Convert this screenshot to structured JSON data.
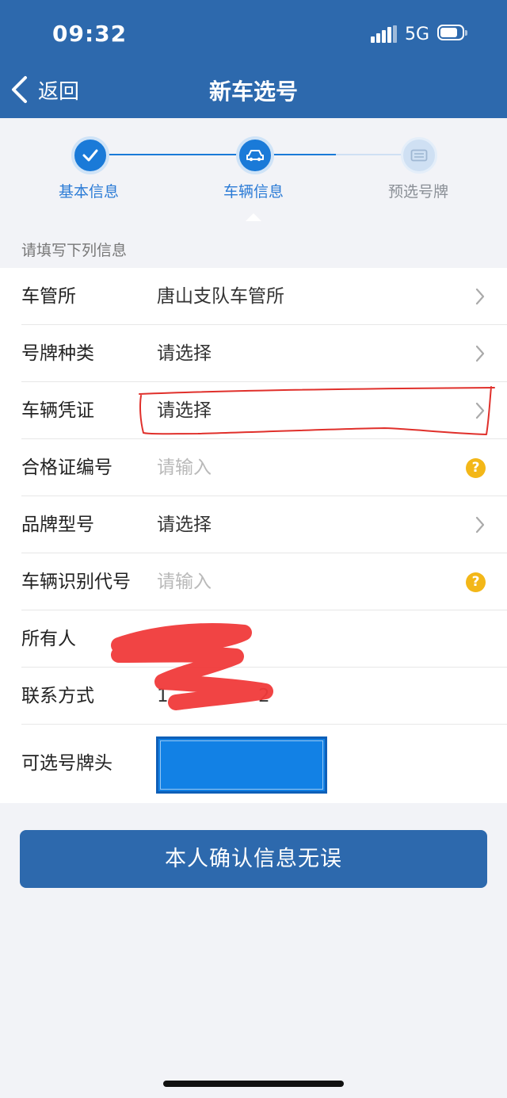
{
  "status_bar": {
    "time": "09:32",
    "network": "5G"
  },
  "nav": {
    "back_label": "返回",
    "title": "新车选号"
  },
  "steps": [
    {
      "label": "基本信息",
      "state": "done"
    },
    {
      "label": "车辆信息",
      "state": "current"
    },
    {
      "label": "预选号牌",
      "state": "pending"
    }
  ],
  "form": {
    "hint": "请填写下列信息",
    "rows": [
      {
        "label": "车管所",
        "value": "唐山支队车管所",
        "control": "chevron"
      },
      {
        "label": "号牌种类",
        "value": "请选择",
        "control": "chevron"
      },
      {
        "label": "车辆凭证",
        "value": "请选择",
        "control": "chevron"
      },
      {
        "label": "合格证编号",
        "placeholder": "请输入",
        "control": "help-icon"
      },
      {
        "label": "品牌型号",
        "value": "请选择",
        "control": "chevron"
      },
      {
        "label": "车辆识别代号",
        "placeholder": "请输入",
        "control": "help-icon"
      },
      {
        "label": "所有人",
        "value": ""
      },
      {
        "label": "联系方式",
        "value": "1",
        "value_tail": "2"
      },
      {
        "label": "可选号牌头",
        "value": ""
      }
    ],
    "help_glyph": "?"
  },
  "confirm_button": {
    "label": "本人确认信息无误"
  },
  "colors": {
    "brand_blue": "#2d69ad",
    "step_active": "#1a7ad8",
    "step_label_active": "#2b7bd6",
    "step_label_pending": "#8a8f96",
    "help_icon": "#f3b718",
    "annotation_red": "#e0302b"
  }
}
